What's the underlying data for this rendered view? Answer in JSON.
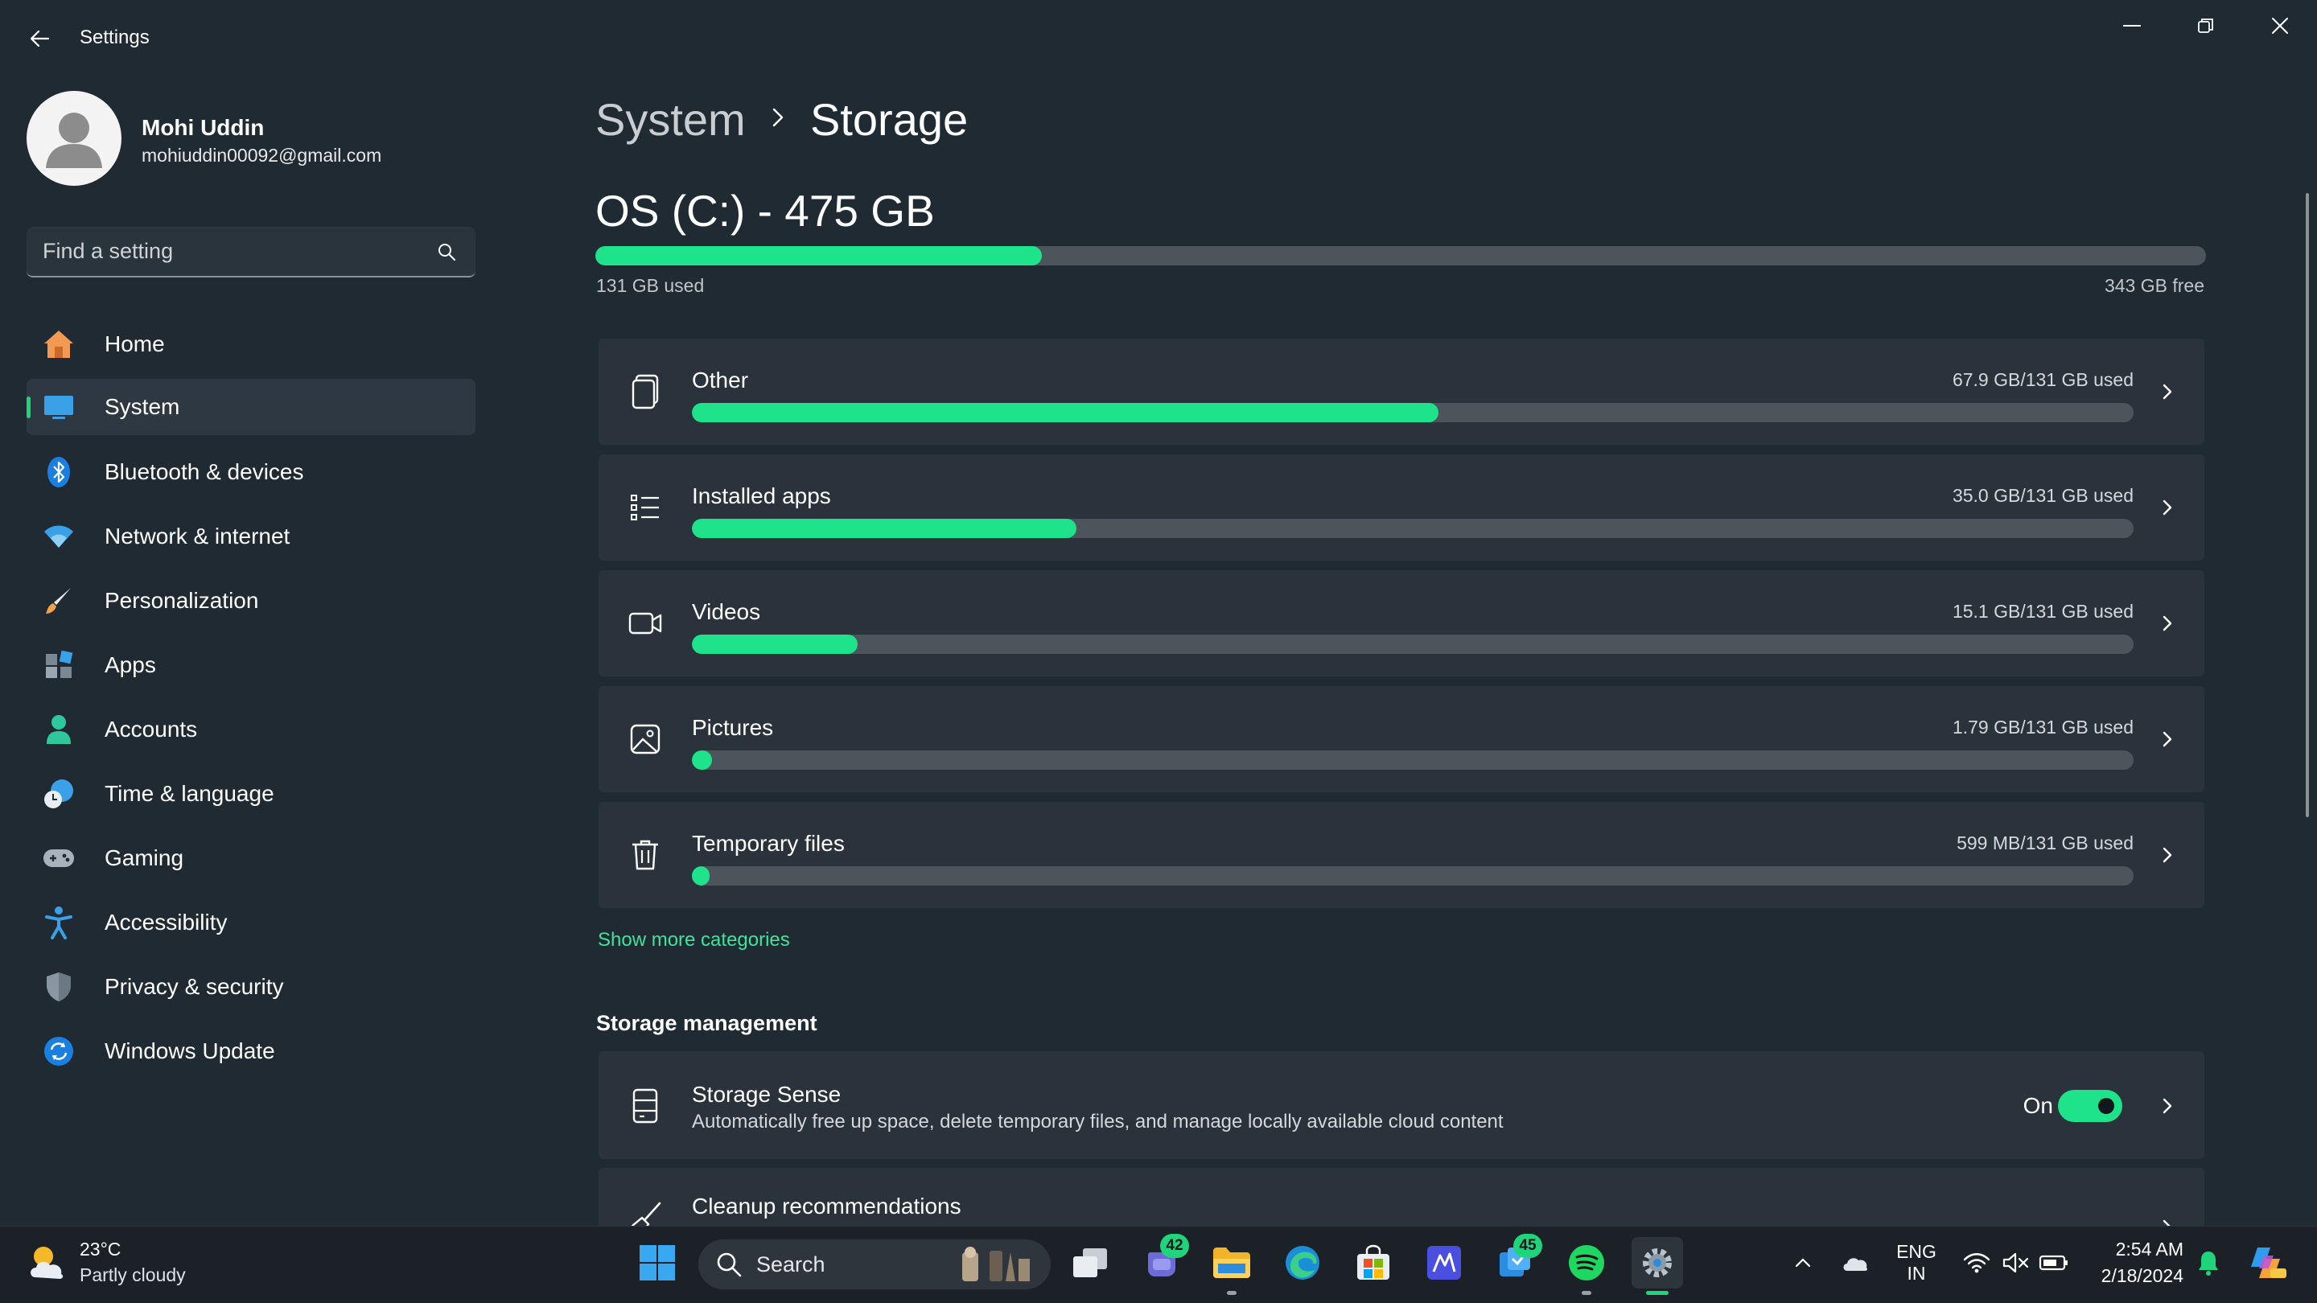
{
  "window": {
    "title": "Settings"
  },
  "profile": {
    "name": "Mohi Uddin",
    "email": "mohiuddin00092@gmail.com"
  },
  "search": {
    "placeholder": "Find a setting"
  },
  "sidebar": {
    "items": [
      {
        "label": "Home",
        "icon": "home-icon",
        "active": false
      },
      {
        "label": "System",
        "icon": "system-icon",
        "active": true
      },
      {
        "label": "Bluetooth & devices",
        "icon": "bluetooth-icon",
        "active": false
      },
      {
        "label": "Network & internet",
        "icon": "wifi-icon",
        "active": false
      },
      {
        "label": "Personalization",
        "icon": "brush-icon",
        "active": false
      },
      {
        "label": "Apps",
        "icon": "apps-icon",
        "active": false
      },
      {
        "label": "Accounts",
        "icon": "account-icon",
        "active": false
      },
      {
        "label": "Time & language",
        "icon": "clock-globe-icon",
        "active": false
      },
      {
        "label": "Gaming",
        "icon": "gamepad-icon",
        "active": false
      },
      {
        "label": "Accessibility",
        "icon": "accessibility-icon",
        "active": false
      },
      {
        "label": "Privacy & security",
        "icon": "shield-icon",
        "active": false
      },
      {
        "label": "Windows Update",
        "icon": "update-icon",
        "active": false
      }
    ]
  },
  "header": {
    "breadcrumb_parent": "System",
    "breadcrumb_current": "Storage"
  },
  "drive": {
    "title": "OS (C:) - 475 GB",
    "used_label": "131 GB used",
    "free_label": "343 GB free",
    "used_fraction": 0.277
  },
  "categories": [
    {
      "name": "Other",
      "used": "67.9 GB/131 GB used",
      "fraction": 0.518,
      "icon": "document-icon"
    },
    {
      "name": "Installed apps",
      "used": "35.0 GB/131 GB used",
      "fraction": 0.267,
      "icon": "list-icon"
    },
    {
      "name": "Videos",
      "used": "15.1 GB/131 GB used",
      "fraction": 0.115,
      "icon": "video-icon"
    },
    {
      "name": "Pictures",
      "used": "1.79 GB/131 GB used",
      "fraction": 0.014,
      "icon": "picture-icon"
    },
    {
      "name": "Temporary files",
      "used": "599 MB/131 GB used",
      "fraction": 0.0045,
      "icon": "trash-icon"
    }
  ],
  "show_more": "Show more categories",
  "storage_management": {
    "heading": "Storage management",
    "storage_sense": {
      "title": "Storage Sense",
      "description": "Automatically free up space, delete temporary files, and manage locally available cloud content",
      "state": "On"
    },
    "cleanup": {
      "title": "Cleanup recommendations"
    }
  },
  "taskbar": {
    "weather_temp": "23°C",
    "weather_desc": "Partly cloudy",
    "search_label": "Search",
    "teams_badge": "42",
    "todo_badge": "45",
    "lang_line1": "ENG",
    "lang_line2": "IN",
    "time": "2:54 AM",
    "date": "2/18/2024"
  },
  "colors": {
    "accent": "#1fe38a",
    "background": "#1f2a33",
    "card": "#2a333c"
  }
}
